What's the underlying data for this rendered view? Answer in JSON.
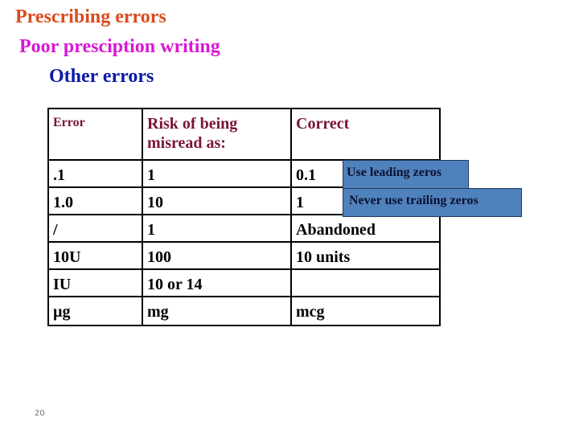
{
  "titles": {
    "line1": "Prescribing errors",
    "line2": "Poor presciption writing",
    "line3": "Other errors"
  },
  "colors": {
    "line1": "#D94A1E",
    "line2": "#D916D6",
    "line3": "#0A1AA8",
    "header_text": "#7A1535",
    "callout_bg": "#4F81BD"
  },
  "table": {
    "headers": [
      "Error",
      "Risk of being misread as:",
      "Correct"
    ],
    "rows": [
      [
        ".1",
        "1",
        "0.1"
      ],
      [
        "1.0",
        "10",
        "1"
      ],
      [
        "/",
        "1",
        "Abandoned"
      ],
      [
        "10U",
        "100",
        "10 units"
      ],
      [
        "IU",
        "10 or 14",
        ""
      ],
      [
        "µg",
        "mg",
        "mcg"
      ]
    ]
  },
  "callouts": {
    "leading": "Use leading zeros",
    "trailing": "Never use trailing zeros"
  },
  "slide_number": "20"
}
